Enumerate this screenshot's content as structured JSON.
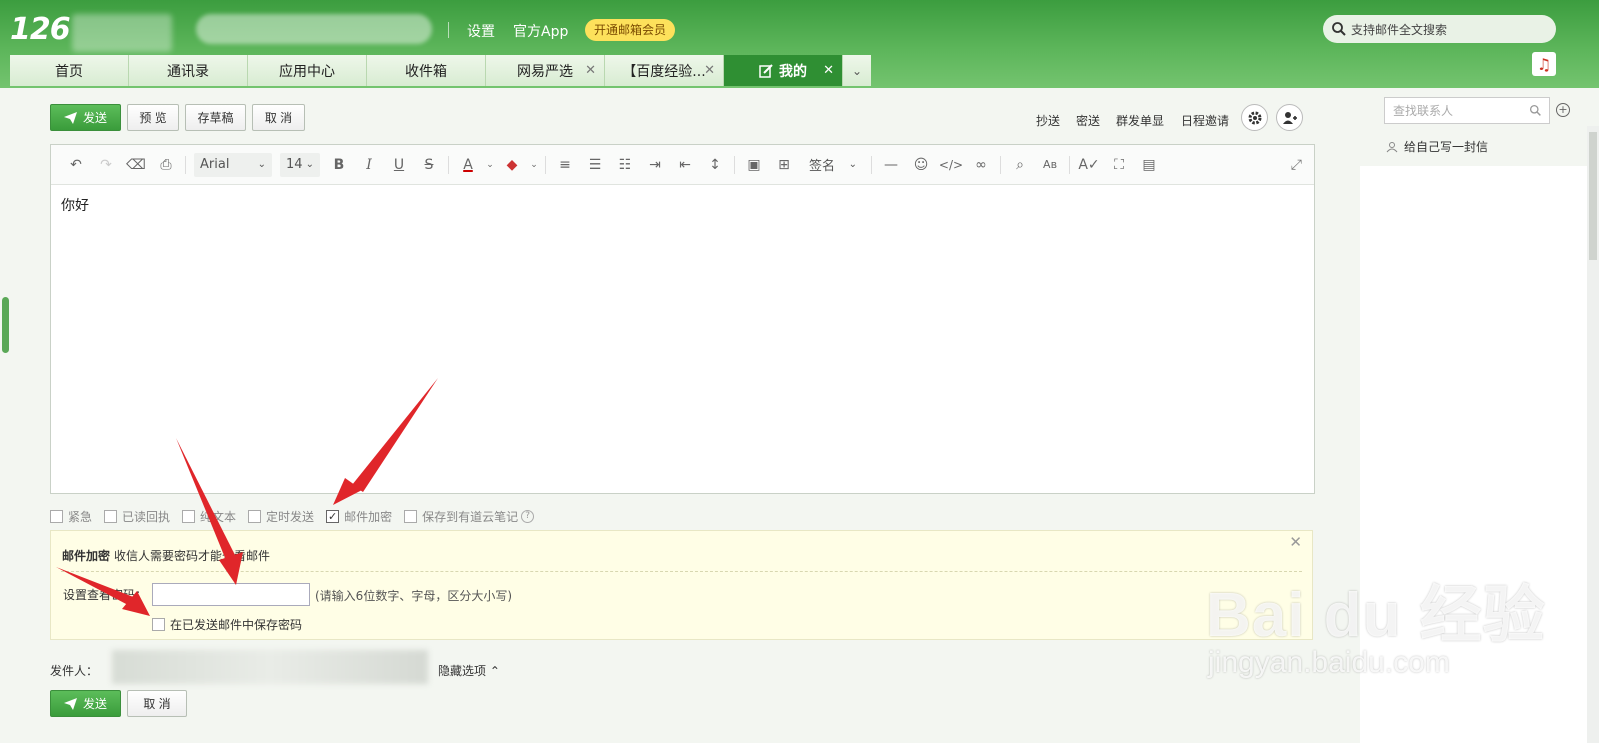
{
  "header": {
    "logo": "126",
    "links": [
      "设置",
      "官方App"
    ],
    "vip_button": "开通邮箱会员",
    "search_placeholder": "支持邮件全文搜索"
  },
  "tabs": [
    {
      "label": "首页",
      "closable": false,
      "active": false
    },
    {
      "label": "通讯录",
      "closable": false,
      "active": false
    },
    {
      "label": "应用中心",
      "closable": false,
      "active": false
    },
    {
      "label": "收件箱",
      "closable": false,
      "active": false
    },
    {
      "label": "网易严选",
      "closable": true,
      "active": false
    },
    {
      "label": "【百度经验...",
      "closable": true,
      "active": false
    },
    {
      "label": "我的",
      "closable": true,
      "active": true
    }
  ],
  "compose_toolbar": {
    "send": "发送",
    "preview": "预 览",
    "draft": "存草稿",
    "cancel": "取 消",
    "cc": "抄送",
    "bcc": "密送",
    "bulk": "群发单显",
    "schedule_invite": "日程邀请"
  },
  "editor": {
    "font_family": "Arial",
    "font_size": "14",
    "signature": "签名",
    "body_text": "你好"
  },
  "options": [
    {
      "label": "紧急",
      "checked": false
    },
    {
      "label": "已读回执",
      "checked": false
    },
    {
      "label": "纯文本",
      "checked": false
    },
    {
      "label": "定时发送",
      "checked": false
    },
    {
      "label": "邮件加密",
      "checked": true
    },
    {
      "label": "保存到有道云笔记",
      "checked": false
    }
  ],
  "encryption": {
    "title": "邮件加密",
    "description": "收信人需要密码才能查看邮件",
    "password_label": "设置查看密码：",
    "password_value": "",
    "password_hint": "(请输入6位数字、字母，区分大小写)",
    "save_password_label": "在已发送邮件中保存密码"
  },
  "sender": {
    "label": "发件人：",
    "hide_options": "隐藏选项"
  },
  "bottom_toolbar": {
    "send": "发送",
    "cancel": "取 消"
  },
  "right_panel": {
    "contact_search_placeholder": "查找联系人",
    "write_to_self": "给自己写一封信"
  },
  "watermark": {
    "brand": "Bai du 经验",
    "url": "jingyan.baidu.com"
  },
  "colors": {
    "brand_green": "#3c9d3f",
    "active_tab": "#2f8f33",
    "vip_yellow": "#fde15b",
    "annotation_red": "#e0262a",
    "panel_yellow": "#fffee6"
  }
}
